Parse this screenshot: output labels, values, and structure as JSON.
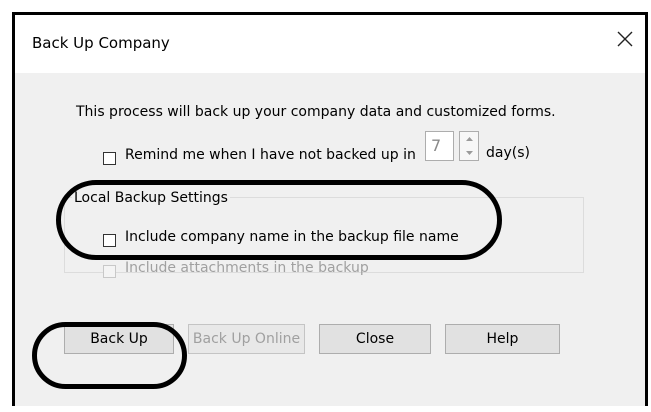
{
  "dialog": {
    "title": "Back Up Company",
    "description": "This process will back up your company data and customized forms.",
    "remind": {
      "label": "Remind me when I have not backed up in",
      "days_value": "7",
      "unit": "day(s)",
      "checked": false
    },
    "local_backup": {
      "group_label": "Local Backup Settings",
      "include_company_name": {
        "label": "Include company name in the backup file name",
        "checked": false
      },
      "include_attachments": {
        "label": "Include attachments in the backup",
        "checked": false,
        "enabled": false
      }
    },
    "buttons": {
      "back_up": "Back Up",
      "back_up_online": "Back Up Online",
      "close": "Close",
      "help": "Help"
    }
  },
  "icons": {
    "close": "close-icon",
    "spin_up": "spin-up-icon",
    "spin_down": "spin-down-icon"
  }
}
